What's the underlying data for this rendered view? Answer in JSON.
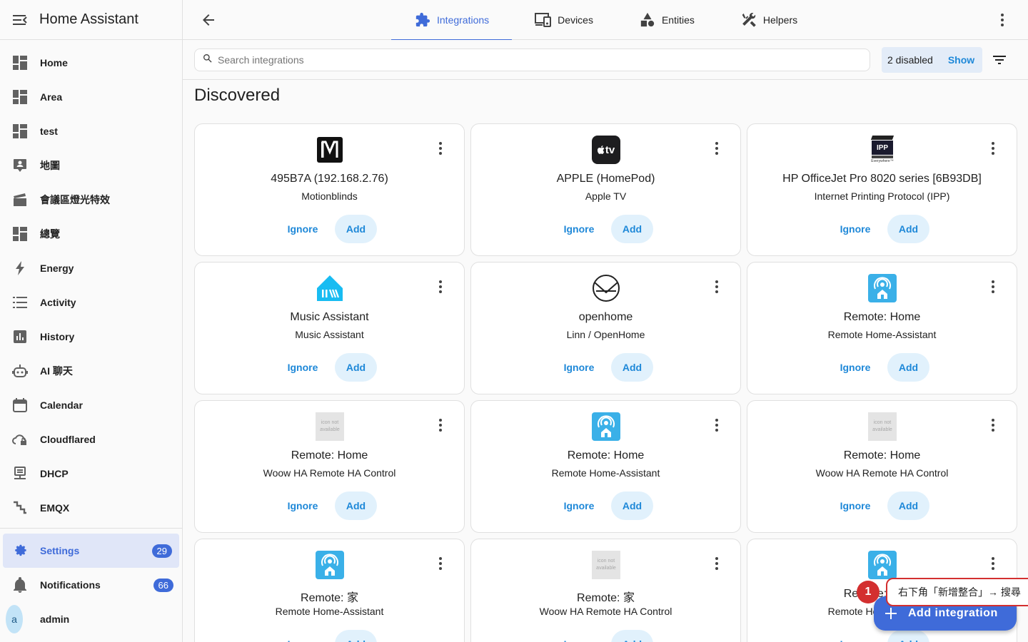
{
  "sidebar": {
    "title": "Home Assistant",
    "items": [
      {
        "label": "Home",
        "icon": "dashboard-icon"
      },
      {
        "label": "Area",
        "icon": "dashboard-icon"
      },
      {
        "label": "test",
        "icon": "dashboard-icon"
      },
      {
        "label": "地圖",
        "icon": "map-account-icon"
      },
      {
        "label": "會議區燈光特效",
        "icon": "movie-icon"
      },
      {
        "label": "總覽",
        "icon": "dashboard-icon"
      },
      {
        "label": "Energy",
        "icon": "lightning-icon"
      },
      {
        "label": "Activity",
        "icon": "list-icon"
      },
      {
        "label": "History",
        "icon": "chart-box-icon"
      },
      {
        "label": "AI 聊天",
        "icon": "robot-icon"
      },
      {
        "label": "Calendar",
        "icon": "calendar-icon"
      },
      {
        "label": "Cloudflared",
        "icon": "cloud-lock-icon"
      },
      {
        "label": "DHCP",
        "icon": "server-network-icon"
      },
      {
        "label": "EMQX",
        "icon": "stairs-icon"
      }
    ],
    "settings": {
      "label": "Settings",
      "badge": "29"
    },
    "notifications": {
      "label": "Notifications",
      "badge": "66"
    },
    "user": {
      "initial": "a",
      "name": "admin"
    }
  },
  "tabs": [
    {
      "label": "Integrations",
      "icon": "puzzle-icon",
      "active": true
    },
    {
      "label": "Devices",
      "icon": "devices-icon",
      "active": false
    },
    {
      "label": "Entities",
      "icon": "shapes-icon",
      "active": false
    },
    {
      "label": "Helpers",
      "icon": "tools-icon",
      "active": false
    }
  ],
  "search": {
    "placeholder": "Search integrations",
    "value": ""
  },
  "disabled_filter": {
    "count_label": "2 disabled",
    "show_label": "Show"
  },
  "section_title": "Discovered",
  "card_actions": {
    "ignore": "Ignore",
    "add": "Add"
  },
  "cards": [
    {
      "name": "495B7A (192.168.2.76)",
      "sub": "Motionblinds",
      "logo": "motionblinds"
    },
    {
      "name": "APPLE (HomePod)",
      "sub": "Apple TV",
      "logo": "appletv"
    },
    {
      "name": "HP OfficeJet Pro 8020 series [6B93DB]",
      "sub": "Internet Printing Protocol (IPP)",
      "logo": "ipp"
    },
    {
      "name": "Music Assistant",
      "sub": "Music Assistant",
      "logo": "music"
    },
    {
      "name": "openhome",
      "sub": "Linn / OpenHome",
      "logo": "openhome"
    },
    {
      "name": "Remote: Home",
      "sub": "Remote Home-Assistant",
      "logo": "remote"
    },
    {
      "name": "Remote: Home",
      "sub": "Woow HA Remote HA Control",
      "logo": "na"
    },
    {
      "name": "Remote: Home",
      "sub": "Remote Home-Assistant",
      "logo": "remote"
    },
    {
      "name": "Remote: Home",
      "sub": "Woow HA Remote HA Control",
      "logo": "na"
    },
    {
      "name": "Remote: 家",
      "sub": "Remote Home-Assistant",
      "logo": "remote"
    },
    {
      "name": "Remote: 家",
      "sub": "Woow HA Remote HA Control",
      "logo": "na"
    },
    {
      "name": "Remote: Home",
      "sub": "Remote Home-Assistant",
      "logo": "remote"
    }
  ],
  "logo_text": {
    "appletv": "tv",
    "ipp": "IPP",
    "ipp_tagline": "Everywhere™",
    "na_line1": "icon not",
    "na_line2": "available"
  },
  "fab": {
    "label": "Add integration"
  },
  "tooltip": {
    "step": "1",
    "text": "右下角「新增整合」→ 搜尋"
  },
  "colors": {
    "primary": "#3f6bd9",
    "accent": "#1e88d8",
    "alert": "#d32f2f"
  }
}
